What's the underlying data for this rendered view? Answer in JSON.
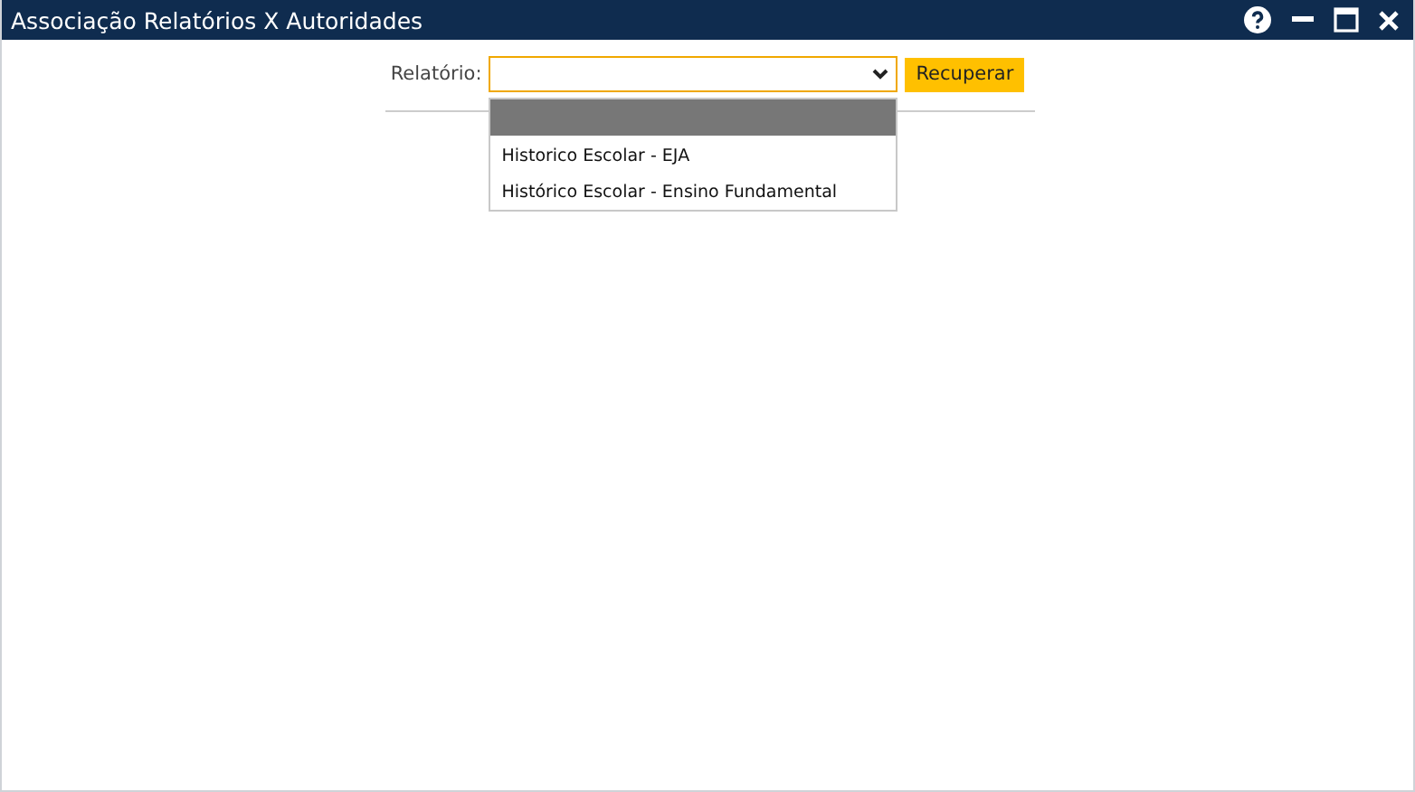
{
  "window": {
    "title": "Associação Relatórios X Autoridades"
  },
  "form": {
    "label": "Relatório:",
    "button": "Recuperar",
    "dropdown_open": true,
    "options": [
      {
        "selected": true
      },
      {
        "label": "Historico Escolar - EJA",
        "selected": false
      },
      {
        "label": "Histórico Escolar - Ensino Fundamental",
        "selected": false
      }
    ]
  }
}
